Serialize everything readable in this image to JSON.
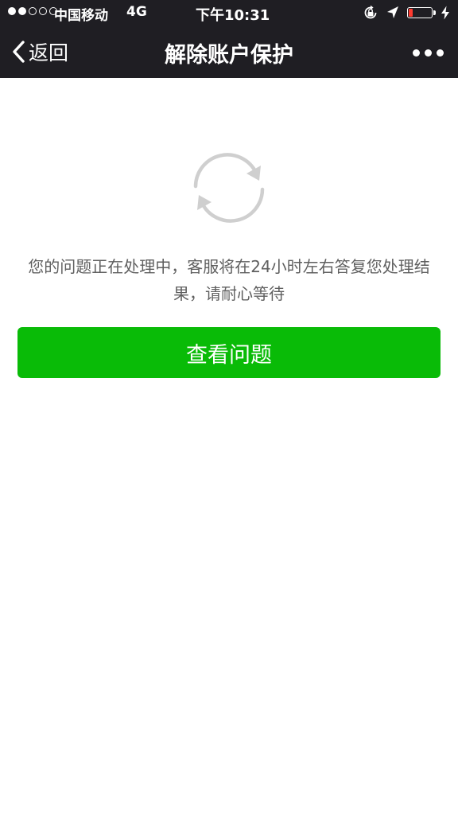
{
  "status_bar": {
    "signal_filled": 2,
    "signal_total": 5,
    "carrier": "中国移动",
    "network": "4G",
    "time": "下午10:31",
    "battery_level": 0.18,
    "battery_color": "#ff3b30",
    "icons": [
      "orientation-lock-icon",
      "location-arrow-icon",
      "battery-icon",
      "charging-bolt-icon"
    ]
  },
  "nav": {
    "back_label": "返回",
    "title": "解除账户保护",
    "more_icon": "more-dots-icon"
  },
  "main": {
    "status_icon": "refresh-icon",
    "message": "您的问题正在处理中，客服将在24小时左右答复您处理结果，请耐心等待",
    "button_label": "查看问题",
    "button_color": "#09bb07",
    "header_color": "#1f1e23"
  }
}
